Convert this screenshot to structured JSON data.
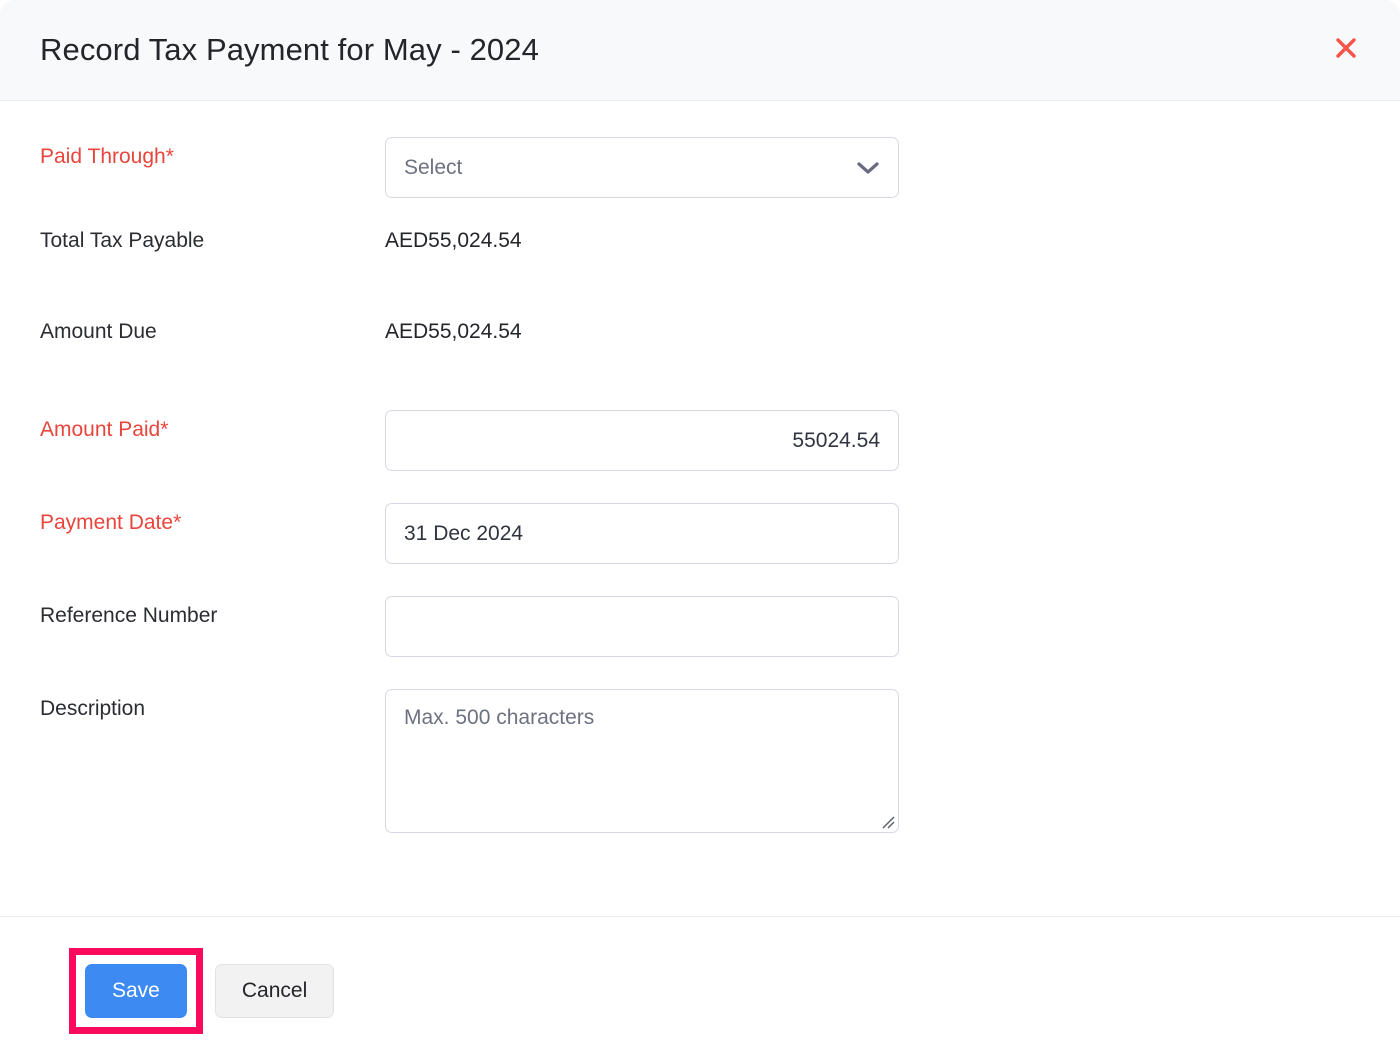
{
  "dialog": {
    "title": "Record Tax Payment for May - 2024",
    "close_icon": "close-icon"
  },
  "form": {
    "paid_through": {
      "label": "Paid Through*",
      "placeholder": "Select",
      "value": "",
      "chevron_icon": "chevron-down-icon"
    },
    "total_tax_payable": {
      "label": "Total Tax Payable",
      "value": "AED55,024.54"
    },
    "amount_due": {
      "label": "Amount Due",
      "value": "AED55,024.54"
    },
    "amount_paid": {
      "label": "Amount Paid*",
      "value": "55024.54",
      "placeholder": ""
    },
    "payment_date": {
      "label": "Payment Date*",
      "value": "31 Dec 2024",
      "placeholder": ""
    },
    "reference_number": {
      "label": "Reference Number",
      "value": "",
      "placeholder": ""
    },
    "description": {
      "label": "Description",
      "value": "",
      "placeholder": "Max. 500 characters"
    }
  },
  "footer": {
    "save_label": "Save",
    "cancel_label": "Cancel"
  },
  "colors": {
    "required_label": "#e8453c",
    "primary_button": "#3d8bf2",
    "highlight_box": "#f90a5c",
    "close_icon": "#f8524b",
    "header_background": "#f8f9fa",
    "field_border": "#d8d8e3"
  }
}
